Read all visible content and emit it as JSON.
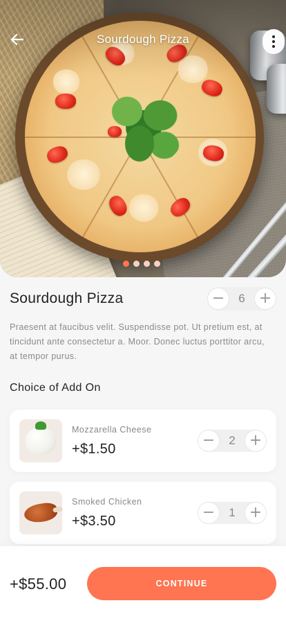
{
  "header": {
    "title": "Sourdough Pizza",
    "back_icon": "arrow-left-icon",
    "more_icon": "more-vertical-icon"
  },
  "carousel": {
    "slide_count": 4,
    "active_index": 0
  },
  "product": {
    "name": "Sourdough Pizza",
    "quantity": "6",
    "description": "Praesent at faucibus velit. Suspendisse pot. Ut  pretium est, at tincidunt ante consectetur a. Moor. Donec luctus porttitor arcu, at tempor purus."
  },
  "addons": {
    "heading": "Choice of Add On",
    "items": [
      {
        "name": "Mozzarella Cheese",
        "price": "+$1.50",
        "quantity": "2"
      },
      {
        "name": "Smoked Chicken",
        "price": "+$3.50",
        "quantity": "1"
      }
    ]
  },
  "footer": {
    "total": "+$55.00",
    "continue_label": "CONTINUE"
  },
  "stepper": {
    "minus": "−",
    "plus": "+"
  },
  "colors": {
    "accent": "#ff7451",
    "background": "#f6f6f6",
    "card": "#ffffff"
  }
}
